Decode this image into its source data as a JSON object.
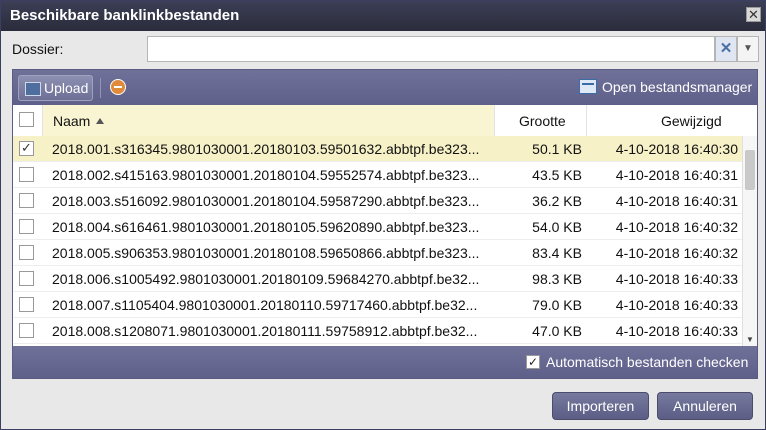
{
  "dialog": {
    "title": "Beschikbare banklinkbestanden",
    "close_glyph": "✕"
  },
  "dossier": {
    "label": "Dossier:",
    "value": "",
    "clear_glyph": "✕",
    "dropdown_glyph": "▼"
  },
  "toolbar": {
    "upload_label": "Upload",
    "filemanager_label": "Open bestandsmanager"
  },
  "table": {
    "columns": {
      "name": "Naam",
      "size": "Grootte",
      "modified": "Gewijzigd"
    },
    "sort": {
      "column": "Naam",
      "direction": "ascending"
    },
    "rows": [
      {
        "name": "2018.001.s316345.9801030001.20180103.59501632.abbtpf.be323...",
        "size": "50.1 KB",
        "modified": "4-10-2018 16:40:30",
        "checked": true
      },
      {
        "name": "2018.002.s415163.9801030001.20180104.59552574.abbtpf.be323...",
        "size": "43.5 KB",
        "modified": "4-10-2018 16:40:31",
        "checked": false
      },
      {
        "name": "2018.003.s516092.9801030001.20180104.59587290.abbtpf.be323...",
        "size": "36.2 KB",
        "modified": "4-10-2018 16:40:31",
        "checked": false
      },
      {
        "name": "2018.004.s616461.9801030001.20180105.59620890.abbtpf.be323...",
        "size": "54.0 KB",
        "modified": "4-10-2018 16:40:32",
        "checked": false
      },
      {
        "name": "2018.005.s906353.9801030001.20180108.59650866.abbtpf.be323...",
        "size": "83.4 KB",
        "modified": "4-10-2018 16:40:32",
        "checked": false
      },
      {
        "name": "2018.006.s1005492.9801030001.20180109.59684270.abbtpf.be32...",
        "size": "98.3 KB",
        "modified": "4-10-2018 16:40:33",
        "checked": false
      },
      {
        "name": "2018.007.s1105404.9801030001.20180110.59717460.abbtpf.be32...",
        "size": "79.0 KB",
        "modified": "4-10-2018 16:40:33",
        "checked": false
      },
      {
        "name": "2018.008.s1208071.9801030001.20180111.59758912.abbtpf.be32...",
        "size": "47.0 KB",
        "modified": "4-10-2018 16:40:33",
        "checked": false
      }
    ]
  },
  "auto_check": {
    "label": "Automatisch bestanden checken",
    "checked": true
  },
  "buttons": {
    "import": "Importeren",
    "cancel": "Annuleren"
  },
  "colors": {
    "titlebar": "#2f3245",
    "toolbar": "#6a6c94",
    "selected_row": "#f7f1c8"
  }
}
